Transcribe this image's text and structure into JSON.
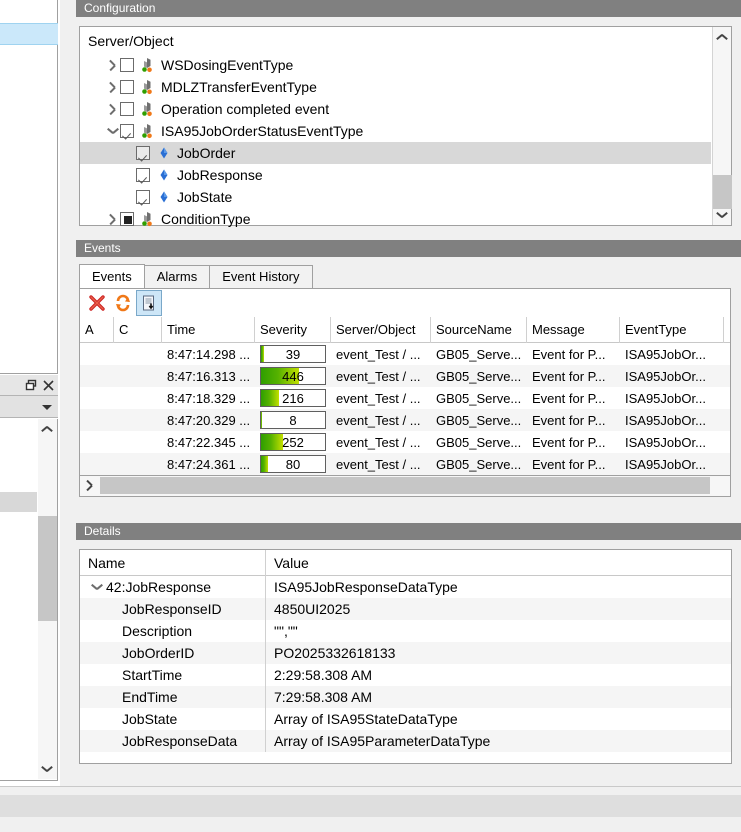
{
  "configuration": {
    "header": "Configuration",
    "tree_column_header": "Server/Object",
    "nodes": [
      {
        "label": "WSDosingEventType",
        "level": 0,
        "expander": "collapsed",
        "check": "unchecked",
        "icon": "event-type-icon",
        "selected": false
      },
      {
        "label": "MDLZTransferEventType",
        "level": 0,
        "expander": "collapsed",
        "check": "unchecked",
        "icon": "event-type-icon",
        "selected": false
      },
      {
        "label": "Operation completed event",
        "level": 0,
        "expander": "collapsed",
        "check": "unchecked",
        "icon": "event-type-icon",
        "selected": false
      },
      {
        "label": "ISA95JobOrderStatusEventType",
        "level": 0,
        "expander": "expanded",
        "check": "checked",
        "icon": "event-type-icon",
        "selected": false
      },
      {
        "label": "JobOrder",
        "level": 1,
        "expander": "none",
        "check": "checked",
        "icon": "property-diamond-icon",
        "selected": true
      },
      {
        "label": "JobResponse",
        "level": 1,
        "expander": "none",
        "check": "checked",
        "icon": "property-diamond-icon",
        "selected": false
      },
      {
        "label": "JobState",
        "level": 1,
        "expander": "none",
        "check": "checked",
        "icon": "property-diamond-icon",
        "selected": false
      },
      {
        "label": "ConditionType",
        "level": 0,
        "expander": "collapsed",
        "check": "partial",
        "icon": "event-type-icon",
        "selected": false
      }
    ]
  },
  "events_panel": {
    "header": "Events",
    "tabs": [
      {
        "label": "Events",
        "active": true
      },
      {
        "label": "Alarms",
        "active": false
      },
      {
        "label": "Event History",
        "active": false
      }
    ],
    "toolbar": [
      {
        "name": "clear-events-button",
        "icon": "red-x-icon",
        "pressed": false
      },
      {
        "name": "refresh-button",
        "icon": "orange-refresh-icon",
        "pressed": false
      },
      {
        "name": "auto-scroll-button",
        "icon": "document-arrow-icon",
        "pressed": true
      }
    ],
    "columns": [
      "A",
      "C",
      "Time",
      "Severity",
      "Server/Object",
      "SourceName",
      "Message",
      "EventType"
    ],
    "rows": [
      {
        "a": "",
        "c": "",
        "time": "8:47:14.298 ...",
        "severity": 39,
        "server_object": "event_Test / ...",
        "source_name": "GB05_Serve...",
        "message": "Event for P...",
        "event_type": "ISA95JobOr..."
      },
      {
        "a": "",
        "c": "",
        "time": "8:47:16.313 ...",
        "severity": 446,
        "server_object": "event_Test / ...",
        "source_name": "GB05_Serve...",
        "message": "Event for P...",
        "event_type": "ISA95JobOr..."
      },
      {
        "a": "",
        "c": "",
        "time": "8:47:18.329 ...",
        "severity": 216,
        "server_object": "event_Test / ...",
        "source_name": "GB05_Serve...",
        "message": "Event for P...",
        "event_type": "ISA95JobOr..."
      },
      {
        "a": "",
        "c": "",
        "time": "8:47:20.329 ...",
        "severity": 8,
        "server_object": "event_Test / ...",
        "source_name": "GB05_Serve...",
        "message": "Event for P...",
        "event_type": "ISA95JobOr..."
      },
      {
        "a": "",
        "c": "",
        "time": "8:47:22.345 ...",
        "severity": 252,
        "server_object": "event_Test / ...",
        "source_name": "GB05_Serve...",
        "message": "Event for P...",
        "event_type": "ISA95JobOr..."
      },
      {
        "a": "",
        "c": "",
        "time": "8:47:24.361 ...",
        "severity": 80,
        "server_object": "event_Test / ...",
        "source_name": "GB05_Serve...",
        "message": "Event for P...",
        "event_type": "ISA95JobOr..."
      }
    ],
    "severity_max": 750
  },
  "details_panel": {
    "header": "Details",
    "columns": {
      "name": "Name",
      "value": "Value"
    },
    "rows": [
      {
        "name": "42:JobResponse",
        "value": "ISA95JobResponseDataType",
        "level": 0,
        "expander": "expanded"
      },
      {
        "name": "JobResponseID",
        "value": "4850UI2025",
        "level": 1,
        "expander": "none"
      },
      {
        "name": "Description",
        "value": "\"\",\"\"",
        "level": 1,
        "expander": "none"
      },
      {
        "name": "JobOrderID",
        "value": "PO2025332618133",
        "level": 1,
        "expander": "none"
      },
      {
        "name": "StartTime",
        "value": "2:29:58.308 AM",
        "level": 1,
        "expander": "none"
      },
      {
        "name": "EndTime",
        "value": "7:29:58.308 AM",
        "level": 1,
        "expander": "none"
      },
      {
        "name": "JobState",
        "value": "Array of ISA95StateDataType",
        "level": 1,
        "expander": "none"
      },
      {
        "name": "JobResponseData",
        "value": "Array of ISA95ParameterDataType",
        "level": 1,
        "expander": "none"
      }
    ]
  },
  "colors": {
    "panel_header_bg": "#808080",
    "selection_blue": "#cbe8fa",
    "selection_gray": "#d8d8d8",
    "severity_green_dark": "#2f9e00",
    "severity_green_light": "#c3e000",
    "toolbar_red": "#cc2222",
    "toolbar_orange": "#f07818"
  }
}
